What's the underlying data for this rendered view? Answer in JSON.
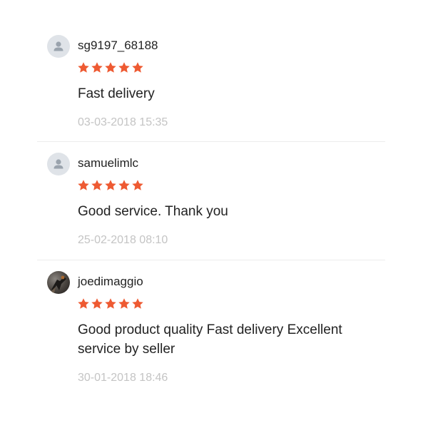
{
  "colors": {
    "star": "#ee5a32",
    "timestamp": "#c4c4c4",
    "avatar_default_bg": "#dfe3e8"
  },
  "reviews": [
    {
      "username": "sg9197_68188",
      "avatar": "default-user-icon",
      "rating": 5,
      "comment": "Fast delivery",
      "timestamp": "03-03-2018 15:35"
    },
    {
      "username": "samuelimlc",
      "avatar": "default-user-icon",
      "rating": 5,
      "comment": "Good service. Thank you",
      "timestamp": "25-02-2018 08:10"
    },
    {
      "username": "joedimaggio",
      "avatar": "profile-photo",
      "rating": 5,
      "comment": "Good product quality Fast delivery Excellent service by seller",
      "timestamp": "30-01-2018 18:46"
    }
  ]
}
